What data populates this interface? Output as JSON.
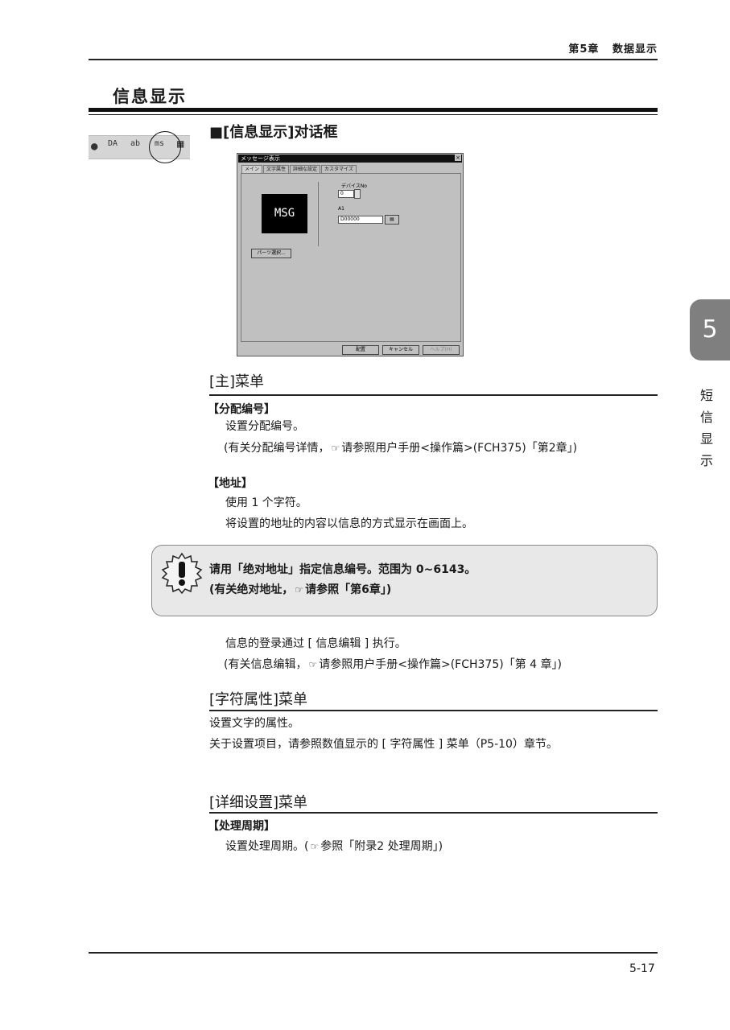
{
  "header": {
    "chapter": "第5章",
    "chapter_title": "数据显示"
  },
  "page_title": "信息显示",
  "toolbar": {
    "icons": [
      "gear-icon",
      "DA",
      "ab",
      "ms",
      "grid"
    ]
  },
  "section_heading": "■[信息显示]对话框",
  "dialog": {
    "title": "メッセージ表示",
    "close": "×",
    "tabs": [
      "メイン",
      "文字属性",
      "詳細な設定",
      "カスタマイズ"
    ],
    "preview_text": "MSG",
    "device_no_label": "デバイスNo",
    "device_no_value": "0",
    "a1_label": "A1",
    "a1_value": "D00000",
    "parts_button": "パーツ選択...",
    "ok_button": "配置",
    "cancel_button": "キャンセル",
    "help_button": "ヘルプ(H)"
  },
  "main_menu": {
    "heading": "[主]菜单",
    "assign": {
      "heading": "【分配编号】",
      "line1": "设置分配编号。",
      "line2_pre": "(有关分配编号详情，",
      "line2_post": "请参照用户手册<操作篇>(FCH375)「第2章」)"
    },
    "address": {
      "heading": "【地址】",
      "line1": "使用 1 个字符。",
      "line2": "将设置的地址的内容以信息的方式显示在画面上。"
    }
  },
  "caution": {
    "line1": "请用「绝对地址」指定信息编号。范围为 0~6143。",
    "line2_pre": "(有关绝对地址，",
    "line2_post": "请参照「第6章」)"
  },
  "after_caution": {
    "line1": "信息的登录通过 [ 信息编辑 ] 执行。",
    "line2_pre": "(有关信息编辑，",
    "line2_post": "请参照用户手册<操作篇>(FCH375)「第 4 章」)"
  },
  "char_attr": {
    "heading": "[字符属性]菜单",
    "line1": "设置文字的属性。",
    "line2": "关于设置项目，请参照数值显示的 [ 字符属性 ] 菜单（P5-10）章节。"
  },
  "detail": {
    "heading": "[详细设置]菜单",
    "sub_heading": "【处理周期】",
    "line1_pre": "设置处理周期。(",
    "line1_post": "参照「附录2  处理周期」)"
  },
  "side_tab": {
    "number": "5",
    "label": [
      "短",
      "信",
      "显",
      "示"
    ]
  },
  "footer": {
    "page_number": "5-17"
  },
  "ref_icon": "☞"
}
